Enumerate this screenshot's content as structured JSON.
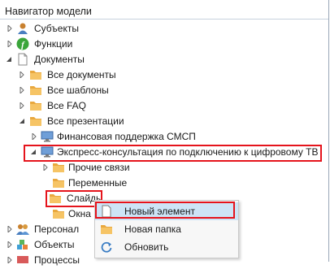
{
  "panel": {
    "title": "Навигатор модели"
  },
  "tree": [
    {
      "label": "Субъекты",
      "icon": "users-icon",
      "arrow": "collapsed"
    },
    {
      "label": "Функции",
      "icon": "function-icon",
      "arrow": "collapsed"
    },
    {
      "label": "Документы",
      "icon": "document-icon",
      "arrow": "expanded"
    },
    {
      "label": "Все документы",
      "icon": "folder-icon",
      "arrow": "collapsed"
    },
    {
      "label": "Все шаблоны",
      "icon": "folder-icon",
      "arrow": "collapsed"
    },
    {
      "label": "Все FAQ",
      "icon": "folder-icon",
      "arrow": "collapsed"
    },
    {
      "label": "Все презентации",
      "icon": "folder-icon",
      "arrow": "expanded"
    },
    {
      "label": "Финансовая поддержка СМСП",
      "icon": "monitor-icon",
      "arrow": "collapsed"
    },
    {
      "label": "Экспресс-консультация по подключению к цифровому ТВ",
      "icon": "monitor-icon",
      "arrow": "expanded"
    },
    {
      "label": "Прочие связи",
      "icon": "folder-icon",
      "arrow": "collapsed"
    },
    {
      "label": "Переменные",
      "icon": "folder-icon",
      "arrow": "none"
    },
    {
      "label": "Слайды",
      "icon": "folder-icon",
      "arrow": "none"
    },
    {
      "label": "Окна",
      "icon": "folder-icon",
      "arrow": "none"
    },
    {
      "label": "Персонал",
      "icon": "users-icon",
      "arrow": "collapsed"
    },
    {
      "label": "Объекты",
      "icon": "cubes-icon",
      "arrow": "collapsed"
    },
    {
      "label": "Процессы",
      "icon": "process-icon",
      "arrow": "collapsed"
    }
  ],
  "context_menu": {
    "items": [
      {
        "label": "Новый элемент",
        "icon": "new-item-icon"
      },
      {
        "label": "Новая папка",
        "icon": "folder-icon"
      },
      {
        "label": "Обновить",
        "icon": "refresh-icon"
      }
    ]
  },
  "colors": {
    "highlight": "#e5141c",
    "selection": "#cde4f6",
    "folder": "#f0b24a"
  }
}
